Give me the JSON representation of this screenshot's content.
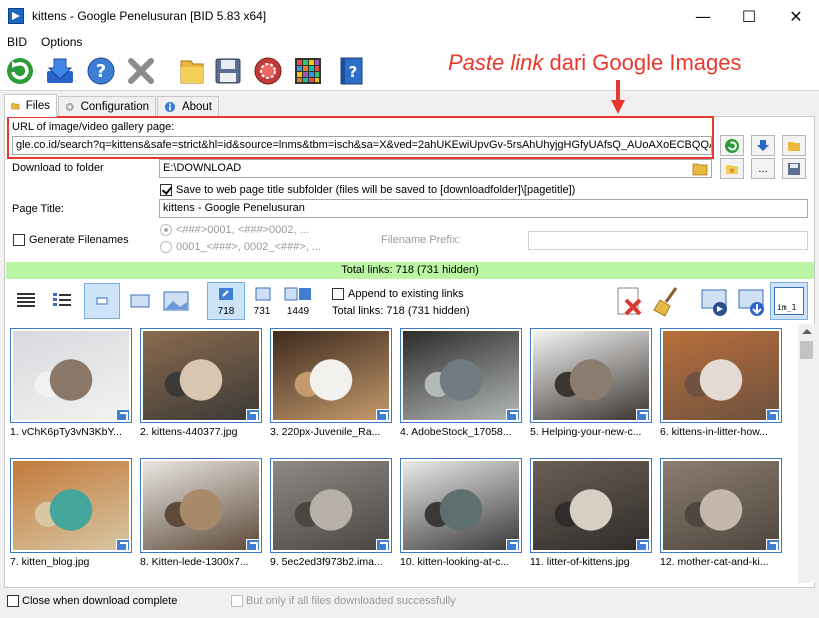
{
  "window": {
    "title": "kittens - Google Penelusuran [BID 5.83 x64]",
    "controls": {
      "minimize": "—",
      "maximize": "☐",
      "close": "✕"
    }
  },
  "menu": [
    "BID",
    "Options"
  ],
  "toolbar": {
    "icons": [
      "refresh-icon",
      "download-icon",
      "help-icon",
      "stop-icon",
      "folder-icon",
      "save-icon",
      "record-icon",
      "grid-icon",
      "book-icon"
    ]
  },
  "annotation": {
    "italic_part": "Paste link",
    "rest": " dari Google Images",
    "color": "#e8382d"
  },
  "tabs": [
    {
      "label": "Files",
      "active": true
    },
    {
      "label": "Configuration",
      "active": false
    },
    {
      "label": "About",
      "active": false
    }
  ],
  "files": {
    "url_label": "URL of image/video gallery page:",
    "url_value": "gle.co.id/search?q=kittens&safe=strict&hl=id&source=lnms&tbm=isch&sa=X&ved=2ahUKEwiUpvGv-5rsAhUhyjgHGfyUAfsQ_AUoAXoECBQQAw&",
    "folder_label": "Download to folder",
    "folder_value": "E:\\DOWNLOAD",
    "folder_more": "...",
    "save_subfolder_label": "Save to web page title subfolder (files will be saved to [downloadfolder]\\[pagetitle])",
    "page_title_label": "Page Title:",
    "page_title_value": "kittens - Google Penelusuran",
    "generate_filenames_label": "Generate Filenames",
    "pattern1": "<###>0001, <###>0002, ...",
    "pattern2": "0001_<###>, 0002_<###>, ...",
    "prefix_label": "Filename Prefix:",
    "prefix_value": ""
  },
  "total_links_bar": "Total links: 718 (731 hidden)",
  "view": {
    "counts": [
      "718",
      "731",
      "1449"
    ],
    "append_label": "Append to existing links",
    "total_label": "Total links: 718 (731 hidden)",
    "im_label": "im_1"
  },
  "thumbnails": [
    {
      "caption": "1. vChK6pTy3vN3KbY...",
      "colors": [
        "#d8d9dd",
        "#8a7767",
        "#f2f2f2"
      ]
    },
    {
      "caption": "2. kittens-440377.jpg",
      "colors": [
        "#8a6a4e",
        "#d9c6b0",
        "#3c3a37"
      ]
    },
    {
      "caption": "3. 220px-Juvenile_Ra...",
      "colors": [
        "#3e2a1e",
        "#f3f1ee",
        "#c49a6c"
      ]
    },
    {
      "caption": "4. AdobeStock_17058...",
      "colors": [
        "#2d2b2a",
        "#6f7b80",
        "#b3b8b8"
      ]
    },
    {
      "caption": "5. Helping-your-new-c...",
      "colors": [
        "#f4f4f4",
        "#8a7d6f",
        "#3b3530"
      ]
    },
    {
      "caption": "6. kittens-in-litter-how...",
      "colors": [
        "#b86f3a",
        "#e2dad3",
        "#6e5140"
      ]
    },
    {
      "caption": "7. kitten_blog.jpg",
      "colors": [
        "#c27a3b",
        "#44a59a",
        "#d8c6a3"
      ]
    },
    {
      "caption": "8. Kitten-lede-1300x7...",
      "colors": [
        "#e9e6e1",
        "#a88a6a",
        "#5d4a3a"
      ]
    },
    {
      "caption": "9. 5ec2ed3f973b2.ima...",
      "colors": [
        "#8d8a86",
        "#b7b1a8",
        "#4b4641"
      ]
    },
    {
      "caption": "10. kitten-looking-at-c...",
      "colors": [
        "#eaeaea",
        "#5d6f6e",
        "#3b3937"
      ]
    },
    {
      "caption": "11. litter-of-kittens.jpg",
      "colors": [
        "#6b5f55",
        "#d7cec4",
        "#2f2c2a"
      ]
    },
    {
      "caption": "12. mother-cat-and-ki...",
      "colors": [
        "#8b7d6f",
        "#c4b8aa",
        "#4e463f"
      ]
    }
  ],
  "status": {
    "close_label": "Close when download complete",
    "only_if_label": "But only if all files downloaded successfully"
  }
}
